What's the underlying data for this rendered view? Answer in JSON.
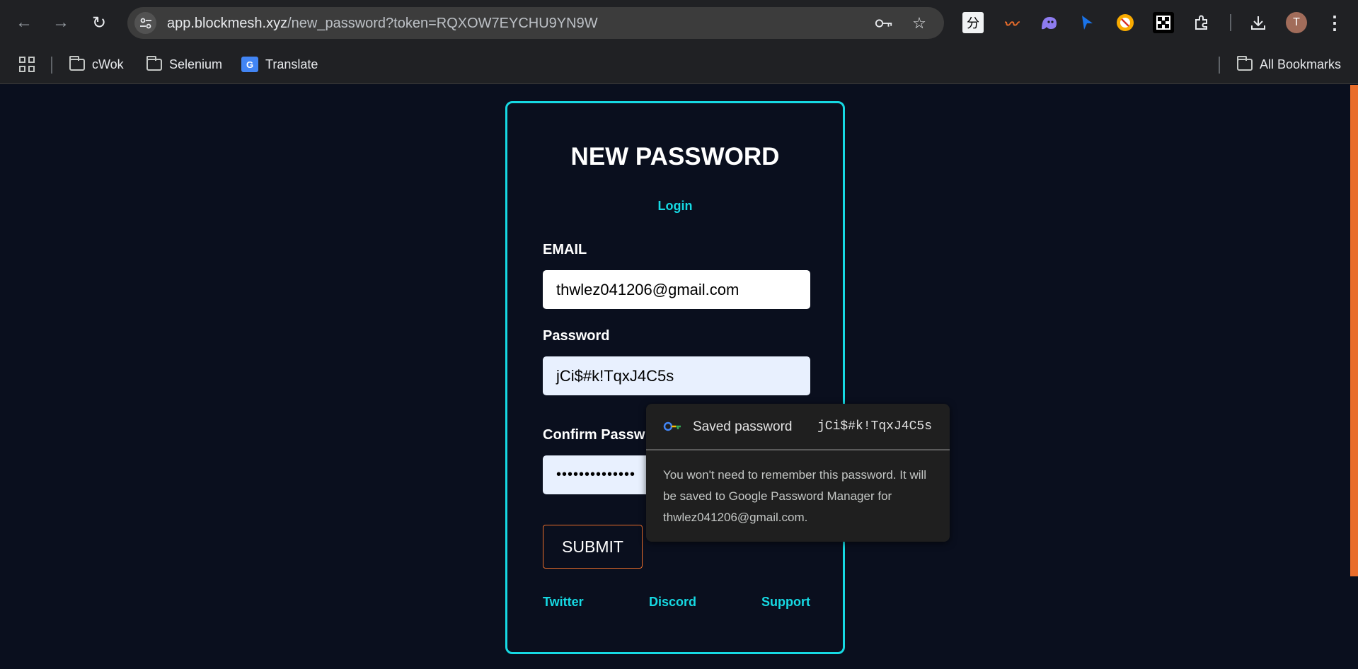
{
  "browser": {
    "url_host": "app.blockmesh.xyz",
    "url_path": "/new_password?token=RQXOW7EYCHU9YN9W",
    "profile_initial": "T",
    "translate_ext_label": "分",
    "bookmarks": [
      {
        "label": "cWok"
      },
      {
        "label": "Selenium"
      },
      {
        "label": "Translate"
      }
    ],
    "all_bookmarks": "All Bookmarks",
    "translate_badge": "G"
  },
  "page": {
    "title": "NEW PASSWORD",
    "login_link": "Login",
    "email_label": "EMAIL",
    "email_value": "thwlez041206@gmail.com",
    "password_label": "Password",
    "password_value": "jCi$#k!TqxJ4C5s",
    "confirm_label": "Confirm Passw",
    "confirm_value": "••••••••••••••",
    "submit_label": "SUBMIT",
    "footer_links": [
      "Twitter",
      "Discord",
      "Support"
    ]
  },
  "password_popup": {
    "saved_label": "Saved password",
    "saved_value": "jCi$#k!TqxJ4C5s",
    "message": "You won't need to remember this password. It will be saved to Google Password Manager for thwlez041206@gmail.com."
  },
  "colors": {
    "accent_cyan": "#16d9e3",
    "accent_orange": "#e96d2b",
    "page_bg": "#0a0f1e"
  }
}
